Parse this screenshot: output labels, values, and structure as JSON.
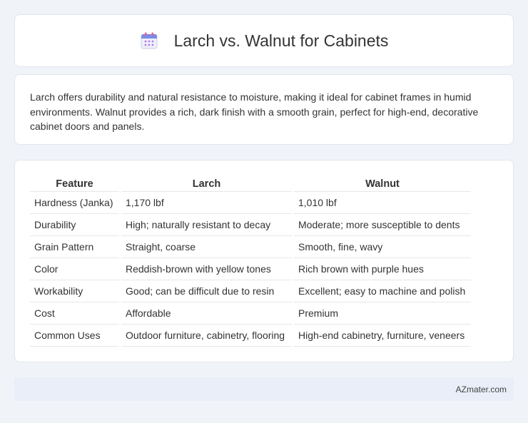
{
  "header": {
    "title": "Larch vs. Walnut for Cabinets",
    "icon": "calendar-icon"
  },
  "description": {
    "text": "Larch offers durability and natural resistance to moisture, making it ideal for cabinet frames in humid environments. Walnut provides a rich, dark finish with a smooth grain, perfect for high-end, decorative cabinet doors and panels."
  },
  "table": {
    "headers": [
      "Feature",
      "Larch",
      "Walnut"
    ],
    "rows": [
      [
        "Hardness (Janka)",
        "1,170 lbf",
        "1,010 lbf"
      ],
      [
        "Durability",
        "High; naturally resistant to decay",
        "Moderate; more susceptible to dents"
      ],
      [
        "Grain Pattern",
        "Straight, coarse",
        "Smooth, fine, wavy"
      ],
      [
        "Color",
        "Reddish-brown with yellow tones",
        "Rich brown with purple hues"
      ],
      [
        "Workability",
        "Good; can be difficult due to resin",
        "Excellent; easy to machine and polish"
      ],
      [
        "Cost",
        "Affordable",
        "Premium"
      ],
      [
        "Common Uses",
        "Outdoor furniture, cabinetry, flooring",
        "High-end cabinetry, furniture, veneers"
      ]
    ]
  },
  "footer": {
    "text": "AZmater.com"
  },
  "colors": {
    "background": "#f0f3f8",
    "card": "#ffffff",
    "footer_bg": "#e9eef8"
  }
}
